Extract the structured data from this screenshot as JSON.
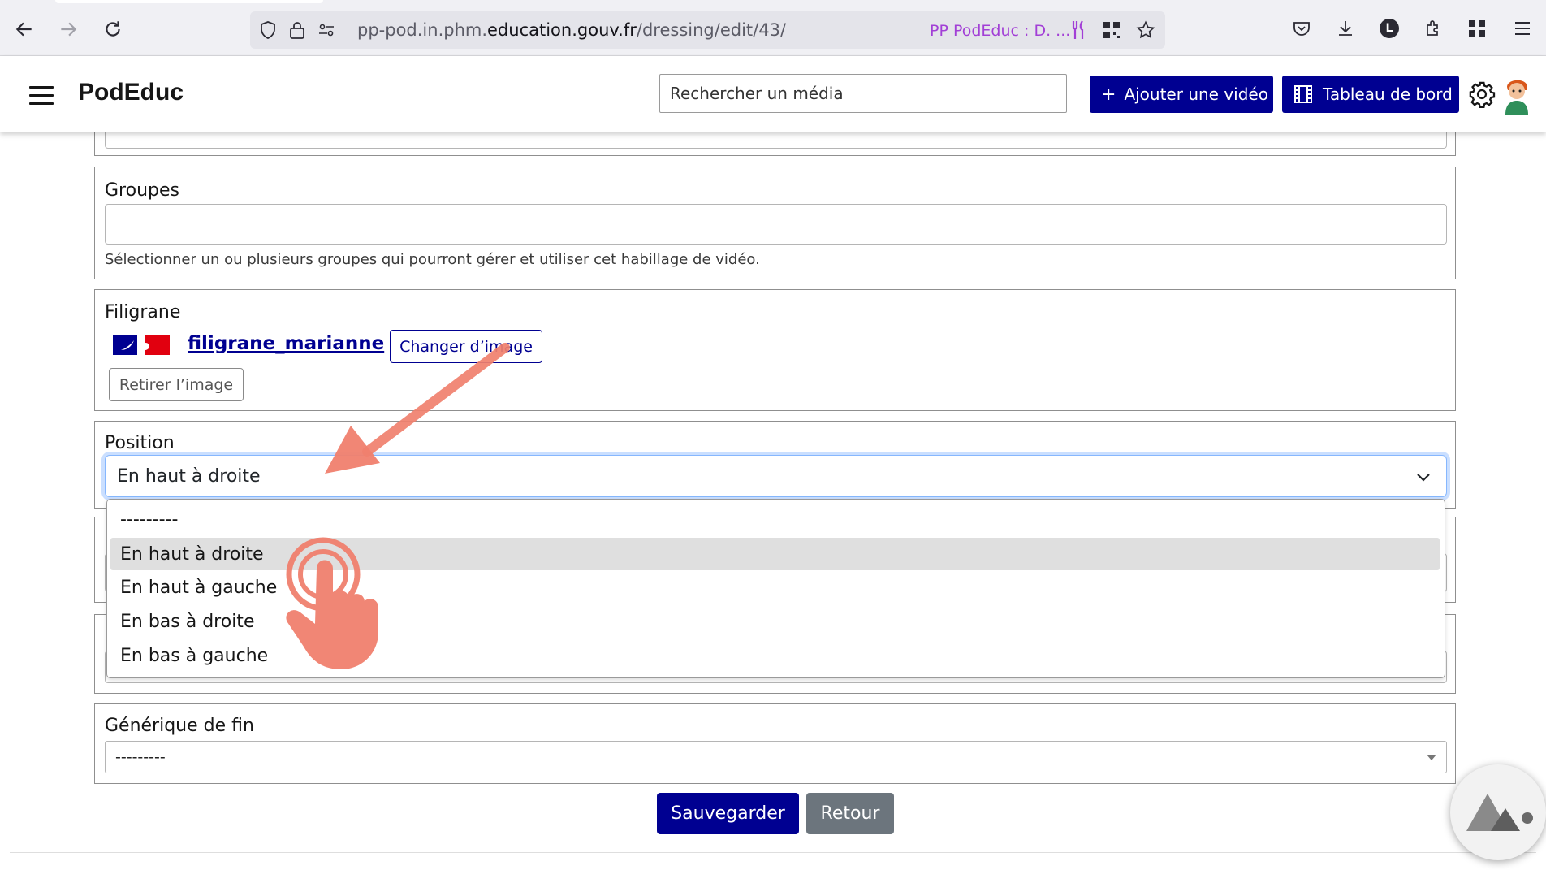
{
  "browser": {
    "url_prefix": "pp-pod.in.phm.",
    "url_host": "education.gouv.fr",
    "url_path": "/dressing/edit/43/",
    "site_title": "PP PodEduc : D. ...",
    "profile_initial": "L"
  },
  "header": {
    "brand": "PodEduc",
    "search_placeholder": "Rechercher un média",
    "add_video_label": "Ajouter une vidéo",
    "dashboard_label": "Tableau de bord"
  },
  "form": {
    "groups": {
      "label": "Groupes",
      "help": "Sélectionner un ou plusieurs groupes qui pourront gérer et utiliser cet habillage de vidéo."
    },
    "watermark": {
      "label": "Filigrane",
      "file_name": "filigrane_marianne",
      "change_label": "Changer d’image",
      "remove_label": "Retirer l’image"
    },
    "position": {
      "label": "Position",
      "selected": "En haut à droite",
      "options": [
        "---------",
        "En haut à droite",
        "En haut à gauche",
        "En bas à droite",
        "En bas à gauche"
      ]
    },
    "end_credits": {
      "label": "Générique de fin",
      "selected": "---------"
    },
    "save_label": "Sauvegarder",
    "back_label": "Retour"
  },
  "colors": {
    "primary": "#000091",
    "secondary": "#6c757d",
    "annotation": "#f0806e"
  },
  "icons": [
    "back-icon",
    "forward-icon",
    "reload-icon",
    "shield-icon",
    "lock-icon",
    "permissions-icon",
    "fork-knife-icon",
    "qr-icon",
    "star-icon",
    "pocket-icon",
    "download-icon",
    "extensions-icon",
    "grid-icon",
    "menu-icon",
    "hamburger-icon",
    "plus-icon",
    "film-icon",
    "gear-icon",
    "chevron-down-icon",
    "pointer-hand-icon"
  ]
}
